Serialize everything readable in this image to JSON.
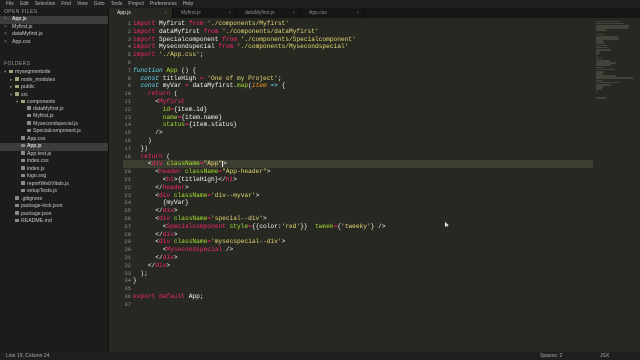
{
  "menu": [
    "File",
    "Edit",
    "Selection",
    "Find",
    "View",
    "Goto",
    "Tools",
    "Project",
    "Preferences",
    "Help"
  ],
  "sidebar": {
    "open_files_heading": "OPEN FILES",
    "open_files": [
      {
        "label": "App.js",
        "active": true
      },
      {
        "label": "Myfirst.js",
        "active": false
      },
      {
        "label": "dataMyfirst.js",
        "active": false
      },
      {
        "label": "App.css",
        "active": false
      }
    ],
    "folders_heading": "FOLDERS",
    "tree": [
      {
        "label": "mysegmentode",
        "depth": 0,
        "kind": "folder",
        "arrow": "▾"
      },
      {
        "label": "node_modules",
        "depth": 1,
        "kind": "folder",
        "arrow": "▸"
      },
      {
        "label": "public",
        "depth": 1,
        "kind": "folder",
        "arrow": "▸"
      },
      {
        "label": "src",
        "depth": 1,
        "kind": "folder",
        "arrow": "▾"
      },
      {
        "label": "components",
        "depth": 2,
        "kind": "folder",
        "arrow": "▾"
      },
      {
        "label": "dataMyfirst.js",
        "depth": 3,
        "kind": "file",
        "arrow": ""
      },
      {
        "label": "Myfirst.js",
        "depth": 3,
        "kind": "file",
        "arrow": ""
      },
      {
        "label": "Mysecondspecial.js",
        "depth": 3,
        "kind": "file",
        "arrow": ""
      },
      {
        "label": "Specialcomponent.js",
        "depth": 3,
        "kind": "file",
        "arrow": ""
      },
      {
        "label": "App.css",
        "depth": 2,
        "kind": "file",
        "arrow": ""
      },
      {
        "label": "App.js",
        "depth": 2,
        "kind": "file",
        "arrow": "",
        "active": true
      },
      {
        "label": "App.test.js",
        "depth": 2,
        "kind": "file",
        "arrow": ""
      },
      {
        "label": "index.css",
        "depth": 2,
        "kind": "file",
        "arrow": ""
      },
      {
        "label": "index.js",
        "depth": 2,
        "kind": "file",
        "arrow": ""
      },
      {
        "label": "logo.svg",
        "depth": 2,
        "kind": "file",
        "arrow": ""
      },
      {
        "label": "reportWebVitals.js",
        "depth": 2,
        "kind": "file",
        "arrow": ""
      },
      {
        "label": "setupTests.js",
        "depth": 2,
        "kind": "file",
        "arrow": ""
      },
      {
        "label": ".gitignore",
        "depth": 1,
        "kind": "file",
        "arrow": ""
      },
      {
        "label": "package-lock.json",
        "depth": 1,
        "kind": "file",
        "arrow": ""
      },
      {
        "label": "package.json",
        "depth": 1,
        "kind": "file",
        "arrow": ""
      },
      {
        "label": "README.md",
        "depth": 1,
        "kind": "file",
        "arrow": ""
      }
    ]
  },
  "tabs": [
    {
      "label": "App.js",
      "active": true
    },
    {
      "label": "Myfirst.js",
      "active": false
    },
    {
      "label": "dataMyfirst.js",
      "active": false
    },
    {
      "label": "App.css",
      "active": false
    }
  ],
  "editor": {
    "start_line": 1,
    "current_line": 19,
    "caret_line": 19,
    "lines": [
      [
        [
          "kw",
          "import "
        ],
        [
          "plain",
          "Myfirst "
        ],
        [
          "kw",
          "from "
        ],
        [
          "str",
          "'./components/Myfirst'"
        ]
      ],
      [
        [
          "kw",
          "import "
        ],
        [
          "plain",
          "dataMyfirst "
        ],
        [
          "kw",
          "from "
        ],
        [
          "str",
          "'./components/dataMyfirst'"
        ]
      ],
      [
        [
          "kw",
          "import "
        ],
        [
          "plain",
          "Specialcomponent "
        ],
        [
          "kw",
          "from "
        ],
        [
          "str",
          "'./components/Specialcomponent'"
        ]
      ],
      [
        [
          "kw",
          "import "
        ],
        [
          "plain",
          "Mysecondspecial "
        ],
        [
          "kw",
          "from "
        ],
        [
          "str",
          "'./components/Mysecondspecial'"
        ]
      ],
      [
        [
          "kw",
          "import "
        ],
        [
          "str",
          "'./App.css'"
        ],
        [
          "plain",
          ";"
        ]
      ],
      [],
      [
        [
          "storage",
          "function "
        ],
        [
          "fn",
          "App"
        ],
        [
          "plain",
          " () {"
        ]
      ],
      [
        [
          "plain",
          "  "
        ],
        [
          "storage",
          "const "
        ],
        [
          "plain",
          "titleHigh "
        ],
        [
          "kw",
          "= "
        ],
        [
          "str",
          "'One of my Project'"
        ],
        [
          "plain",
          ";"
        ]
      ],
      [
        [
          "plain",
          "  "
        ],
        [
          "storage",
          "const "
        ],
        [
          "plain",
          "myVar "
        ],
        [
          "kw",
          "= "
        ],
        [
          "plain",
          "dataMyfirst."
        ],
        [
          "fn",
          "map"
        ],
        [
          "plain",
          "("
        ],
        [
          "param",
          "item"
        ],
        [
          "plain",
          " "
        ],
        [
          "storage",
          "=>"
        ],
        [
          "plain",
          " {"
        ]
      ],
      [
        [
          "plain",
          "    "
        ],
        [
          "kw",
          "return"
        ],
        [
          "plain",
          " ("
        ]
      ],
      [
        [
          "plain",
          "      <"
        ],
        [
          "tag",
          "Myfirst"
        ]
      ],
      [
        [
          "plain",
          "        "
        ],
        [
          "attr",
          "id"
        ],
        [
          "kw",
          "="
        ],
        [
          "plain",
          "{item.id}"
        ]
      ],
      [
        [
          "plain",
          "        "
        ],
        [
          "attr",
          "name"
        ],
        [
          "kw",
          "="
        ],
        [
          "plain",
          "{item.name}"
        ]
      ],
      [
        [
          "plain",
          "        "
        ],
        [
          "attr",
          "status"
        ],
        [
          "kw",
          "="
        ],
        [
          "plain",
          "{item.status}"
        ]
      ],
      [
        [
          "plain",
          "      />"
        ]
      ],
      [
        [
          "plain",
          "    )"
        ]
      ],
      [
        [
          "plain",
          "  })"
        ]
      ],
      [
        [
          "plain",
          "  "
        ],
        [
          "kw",
          "return"
        ],
        [
          "plain",
          " ("
        ]
      ],
      [
        [
          "plain",
          "    <"
        ],
        [
          "tag",
          "div "
        ],
        [
          "attr",
          "className"
        ],
        [
          "kw",
          "="
        ],
        [
          "str",
          "\"App\""
        ],
        [
          "caret",
          ""
        ],
        [
          "plain",
          ">"
        ]
      ],
      [
        [
          "plain",
          "      <"
        ],
        [
          "tag",
          "header "
        ],
        [
          "attr",
          "className"
        ],
        [
          "kw",
          "="
        ],
        [
          "str",
          "\"App-header\""
        ],
        [
          "plain",
          ">"
        ]
      ],
      [
        [
          "plain",
          "        <"
        ],
        [
          "tag",
          "h1"
        ],
        [
          "plain",
          ">{titleHigh}</"
        ],
        [
          "tag",
          "h1"
        ],
        [
          "plain",
          ">"
        ]
      ],
      [
        [
          "plain",
          "      </"
        ],
        [
          "tag",
          "header"
        ],
        [
          "plain",
          ">"
        ]
      ],
      [
        [
          "plain",
          "      <"
        ],
        [
          "tag",
          "div "
        ],
        [
          "attr",
          "className"
        ],
        [
          "kw",
          "="
        ],
        [
          "str",
          "'div--myvar'"
        ],
        [
          "plain",
          ">"
        ]
      ],
      [
        [
          "plain",
          "        {myVar}"
        ]
      ],
      [
        [
          "plain",
          "      </"
        ],
        [
          "tag",
          "div"
        ],
        [
          "plain",
          ">"
        ]
      ],
      [
        [
          "plain",
          "      <"
        ],
        [
          "tag",
          "div "
        ],
        [
          "attr",
          "className"
        ],
        [
          "kw",
          "="
        ],
        [
          "str",
          "'special--div'"
        ],
        [
          "plain",
          ">"
        ]
      ],
      [
        [
          "plain",
          "        <"
        ],
        [
          "tag",
          "Specialcomponent "
        ],
        [
          "attr",
          "style"
        ],
        [
          "kw",
          "="
        ],
        [
          "plain",
          "{{color:"
        ],
        [
          "str",
          "'red'"
        ],
        [
          "plain",
          "}}  "
        ],
        [
          "attr",
          "tweek"
        ],
        [
          "kw",
          "="
        ],
        [
          "plain",
          "{"
        ],
        [
          "str",
          "'tweeky'"
        ],
        [
          "plain",
          "} />"
        ]
      ],
      [
        [
          "plain",
          "      </"
        ],
        [
          "tag",
          "div"
        ],
        [
          "plain",
          ">"
        ]
      ],
      [
        [
          "plain",
          "      <"
        ],
        [
          "tag",
          "div "
        ],
        [
          "attr",
          "className"
        ],
        [
          "kw",
          "="
        ],
        [
          "str",
          "'mysecspecial--div'"
        ],
        [
          "plain",
          ">"
        ]
      ],
      [
        [
          "plain",
          "        <"
        ],
        [
          "tag",
          "Mysecondspecial "
        ],
        [
          "plain",
          "/>"
        ]
      ],
      [
        [
          "plain",
          "      </"
        ],
        [
          "tag",
          "div"
        ],
        [
          "plain",
          ">"
        ]
      ],
      [
        [
          "plain",
          "    </"
        ],
        [
          "tag",
          "div"
        ],
        [
          "plain",
          ">"
        ]
      ],
      [
        [
          "plain",
          "  );"
        ]
      ],
      [
        [
          "plain",
          "}"
        ]
      ],
      [],
      [
        [
          "kw",
          "export "
        ],
        [
          "kw",
          "default "
        ],
        [
          "plain",
          "App;"
        ]
      ],
      []
    ]
  },
  "status": {
    "left": "Line 19, Column 24",
    "tab_size": "Spaces: 2",
    "syntax": "JSX"
  }
}
